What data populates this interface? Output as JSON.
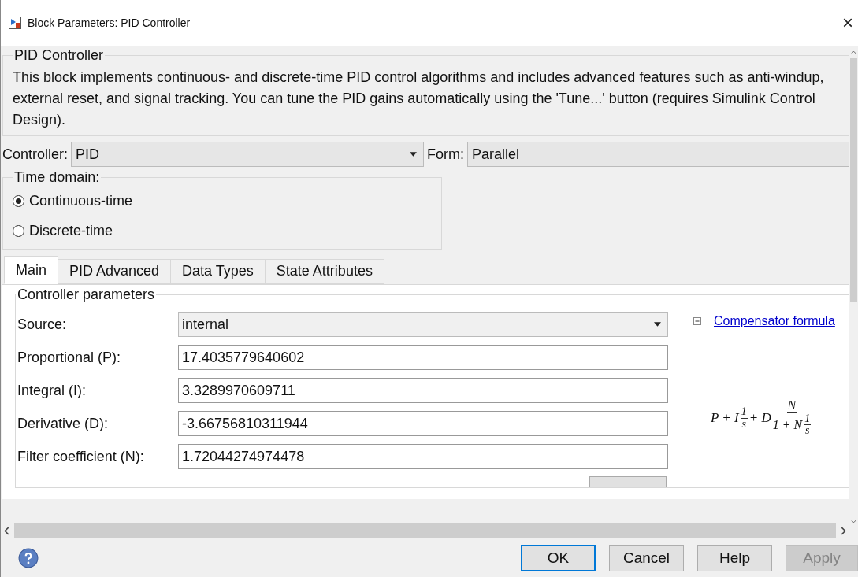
{
  "window": {
    "title": "Block Parameters: PID Controller",
    "close": "×"
  },
  "block": {
    "title": "PID Controller",
    "description": "This block implements continuous- and discrete-time PID control algorithms and includes advanced features such as anti-windup, external reset, and signal tracking. You can tune the PID gains automatically using the 'Tune...' button (requires Simulink Control Design)."
  },
  "controller": {
    "label": "Controller:",
    "value": "PID"
  },
  "form": {
    "label": "Form:",
    "value": "Parallel"
  },
  "time_domain": {
    "title": "Time domain:",
    "options": [
      {
        "label": "Continuous-time",
        "selected": true
      },
      {
        "label": "Discrete-time",
        "selected": false
      }
    ]
  },
  "tabs": [
    {
      "label": "Main",
      "selected": true
    },
    {
      "label": "PID Advanced",
      "selected": false
    },
    {
      "label": "Data Types",
      "selected": false
    },
    {
      "label": "State Attributes",
      "selected": false
    }
  ],
  "parameters": {
    "title": "Controller parameters",
    "fields": [
      {
        "kind": "select",
        "label": "Source:",
        "value": "internal"
      },
      {
        "kind": "text",
        "label": "Proportional (P):",
        "value": "17.4035779640602"
      },
      {
        "kind": "text",
        "label": "Integral (I):",
        "value": "3.3289970609711"
      },
      {
        "kind": "text",
        "label": "Derivative (D):",
        "value": "-3.66756810311944"
      },
      {
        "kind": "text",
        "label": "Filter coefficient (N):",
        "value": "1.72044274974478"
      }
    ],
    "link": {
      "expanded": true,
      "label": "Compensator formula"
    },
    "formula": {
      "lead": "P + I",
      "f1_num": "1",
      "f1_den": "s",
      "mid": "+ D",
      "f2_num": "N",
      "f2_den_lead": "1 + N",
      "f3_num": "1",
      "f3_den": "s"
    }
  },
  "buttons": [
    {
      "label": "OK",
      "default": true,
      "disabled": false
    },
    {
      "label": "Cancel",
      "default": false,
      "disabled": false
    },
    {
      "label": "Help",
      "default": false,
      "disabled": false
    },
    {
      "label": "Apply",
      "default": false,
      "disabled": true
    }
  ]
}
